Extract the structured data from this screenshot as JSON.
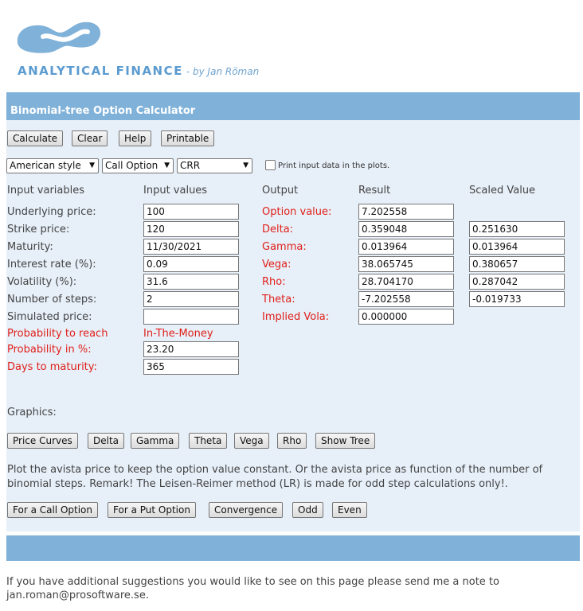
{
  "brand": {
    "name": "ANALYTICAL FINANCE",
    "byline": "- by Jan Röman"
  },
  "panel": {
    "title": "Binomial-tree Option Calculator"
  },
  "toolbar": {
    "calculate": "Calculate",
    "clear": "Clear",
    "help": "Help",
    "printable": "Printable"
  },
  "selects": {
    "style": "American style",
    "option": "Call Option",
    "method": "CRR"
  },
  "print_checkbox": {
    "checked": false,
    "label": "Print input data in the plots."
  },
  "headers": {
    "input_variables": "Input variables",
    "input_values": "Input values",
    "output": "Output",
    "result": "Result",
    "scaled_value": "Scaled Value"
  },
  "inputs": {
    "underlying_label": "Underlying price:",
    "underlying_value": "100",
    "strike_label": "Strike price:",
    "strike_value": "120",
    "maturity_label": "Maturity:",
    "maturity_value": "11/30/2021",
    "interest_label": "Interest rate (%):",
    "interest_value": "0.09",
    "volatility_label": "Volatility (%):",
    "volatility_value": "31.6",
    "steps_label": "Number of steps:",
    "steps_value": "2",
    "simulated_label": "Simulated price:",
    "simulated_value": "",
    "prob_reach_label": "Probability to reach",
    "prob_reach_value": "In-The-Money",
    "prob_pct_label": "Probability in %:",
    "prob_pct_value": "23.20",
    "days_label": "Days to maturity:",
    "days_value": "365"
  },
  "outputs": {
    "option_value_label": "Option value:",
    "option_value": "7.202558",
    "delta_label": "Delta:",
    "delta": "0.359048",
    "delta_scaled": "0.251630",
    "gamma_label": "Gamma:",
    "gamma": "0.013964",
    "gamma_scaled": "0.013964",
    "vega_label": "Vega:",
    "vega": "38.065745",
    "vega_scaled": "0.380657",
    "rho_label": "Rho:",
    "rho": "28.704170",
    "rho_scaled": "0.287042",
    "theta_label": "Theta:",
    "theta": "-7.202558",
    "theta_scaled": "-0.019733",
    "implied_label": "Implied Vola:",
    "implied": "0.000000"
  },
  "graphics": {
    "label": "Graphics:",
    "price_curves": "Price Curves",
    "delta": "Delta",
    "gamma": "Gamma",
    "theta": "Theta",
    "vega": "Vega",
    "rho": "Rho",
    "show_tree": "Show Tree"
  },
  "plot_text": "Plot the avista price to keep the option value constant. Or the avista price as function of the number of binomial steps. Remark! The Leisen-Reimer method (LR) is made for odd step calculations only!.",
  "plot_buttons": {
    "call": "For a Call Option",
    "put": "For a Put Option",
    "convergence": "Convergence",
    "odd": "Odd",
    "even": "Even"
  },
  "footer": "If you have additional suggestions you would like to see on this page please send me a note to jan.roman@prosoftware.se.",
  "colors": {
    "accent_blue": "#7fb1d9",
    "panel_bg": "#e7eff8",
    "red_label": "#e0201a",
    "brand_blue": "#5b9bd0"
  }
}
